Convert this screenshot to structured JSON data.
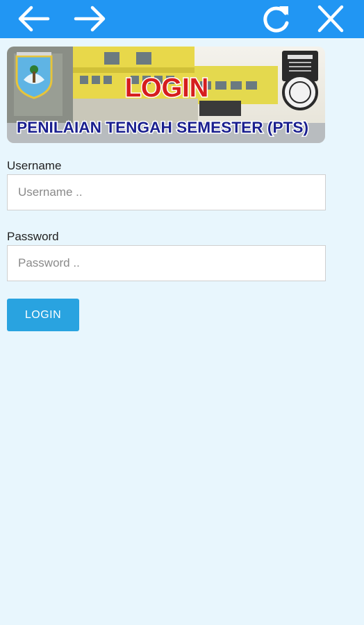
{
  "toolbar": {
    "back_icon": "arrow-left-icon",
    "forward_icon": "arrow-right-icon",
    "reload_icon": "refresh-icon",
    "close_icon": "close-icon",
    "color": "#2196f3"
  },
  "banner": {
    "title": "LOGIN",
    "subtitle": "PENILAIAN TENGAH SEMESTER (PTS)",
    "title_color": "#d61e1e",
    "subtitle_color": "#1a1f8f"
  },
  "form": {
    "username_label": "Username",
    "username_placeholder": "Username ..",
    "username_value": "",
    "password_label": "Password",
    "password_placeholder": "Password ..",
    "password_value": "",
    "login_button": "LOGIN",
    "button_color": "#29a3e0"
  }
}
